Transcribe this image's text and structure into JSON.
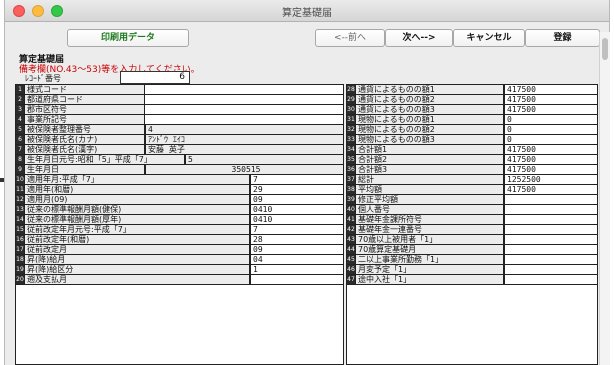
{
  "window": {
    "title": "算定基礎届"
  },
  "toolbar": {
    "print_label": "印刷用データ",
    "prev_label": "<--前へ",
    "next_label": "次へ-->",
    "cancel_label": "キャンセル",
    "register_label": "登録"
  },
  "form": {
    "title": "算定基礎届",
    "note": "備考欄(NO.43～53)等を入力してください。",
    "record_label": "ﾚｺｰﾄﾞ番号",
    "record_value": "6"
  },
  "left_rows": [
    {
      "num": "1",
      "label": "様式コード",
      "value": ""
    },
    {
      "num": "2",
      "label": "都道府県コード",
      "value": ""
    },
    {
      "num": "3",
      "label": "郡市区符号",
      "value": ""
    },
    {
      "num": "4",
      "label": "事業所記号",
      "value": ""
    },
    {
      "num": "5",
      "label": "被保険者整理番号",
      "value": "4"
    },
    {
      "num": "6",
      "label": "被保険者氏名(カナ)",
      "value": "ｱﾝﾄﾞｳ ｴｲｺ"
    },
    {
      "num": "7",
      "label": "被保険者氏名(漢字)",
      "value": "安藤 英子"
    },
    {
      "num": "8",
      "label": "生年月日元号:昭和「5」平成「7」",
      "value": "5"
    },
    {
      "num": "9",
      "label": "生年月日",
      "value": "350515"
    },
    {
      "num": "10",
      "label": "適用年月:平成「7」",
      "value": "7"
    },
    {
      "num": "11",
      "label": "適用年(和暦)",
      "value": "29"
    },
    {
      "num": "12",
      "label": "適用月(09)",
      "value": "09"
    },
    {
      "num": "13",
      "label": "従来の標準報酬月額(健保)",
      "value": "0410"
    },
    {
      "num": "14",
      "label": "従来の標準報酬月額(厚年)",
      "value": "0410"
    },
    {
      "num": "15",
      "label": "従前改定年月元号:平成「7」",
      "value": "7"
    },
    {
      "num": "16",
      "label": "従前改定年(和暦)",
      "value": "28"
    },
    {
      "num": "17",
      "label": "従前改定月",
      "value": "09"
    },
    {
      "num": "18",
      "label": "昇(降)給月",
      "value": "04"
    },
    {
      "num": "19",
      "label": "昇(降)給区分",
      "value": "1"
    },
    {
      "num": "20",
      "label": "遡及支払月",
      "value": ""
    }
  ],
  "right_rows": [
    {
      "num": "28",
      "label": "通貨によるものの額1",
      "value": "417500"
    },
    {
      "num": "29",
      "label": "通貨によるものの額2",
      "value": "417500"
    },
    {
      "num": "30",
      "label": "通貨によるものの額3",
      "value": "417500"
    },
    {
      "num": "31",
      "label": "現物によるものの額1",
      "value": "0"
    },
    {
      "num": "32",
      "label": "現物によるものの額2",
      "value": "0"
    },
    {
      "num": "33",
      "label": "現物によるものの額3",
      "value": "0"
    },
    {
      "num": "34",
      "label": "合計額1",
      "value": "417500"
    },
    {
      "num": "35",
      "label": "合計額2",
      "value": "417500"
    },
    {
      "num": "36",
      "label": "合計額3",
      "value": "417500"
    },
    {
      "num": "37",
      "label": "総計",
      "value": "1252500"
    },
    {
      "num": "38",
      "label": "平均額",
      "value": "417500"
    },
    {
      "num": "39",
      "label": "修正平均額",
      "value": ""
    },
    {
      "num": "40",
      "label": "個人番号",
      "value": ""
    },
    {
      "num": "41",
      "label": "基礎年金課所符号",
      "value": ""
    },
    {
      "num": "42",
      "label": "基礎年金一連番号",
      "value": ""
    },
    {
      "num": "43",
      "label": "70歳以上被用者「1」",
      "value": ""
    },
    {
      "num": "44",
      "label": "70歳算定基礎月",
      "value": ""
    },
    {
      "num": "45",
      "label": "二以上事業所勤務「1」",
      "value": ""
    },
    {
      "num": "46",
      "label": "月変予定「1」",
      "value": ""
    },
    {
      "num": "47",
      "label": "途中入社「1」",
      "value": ""
    }
  ]
}
